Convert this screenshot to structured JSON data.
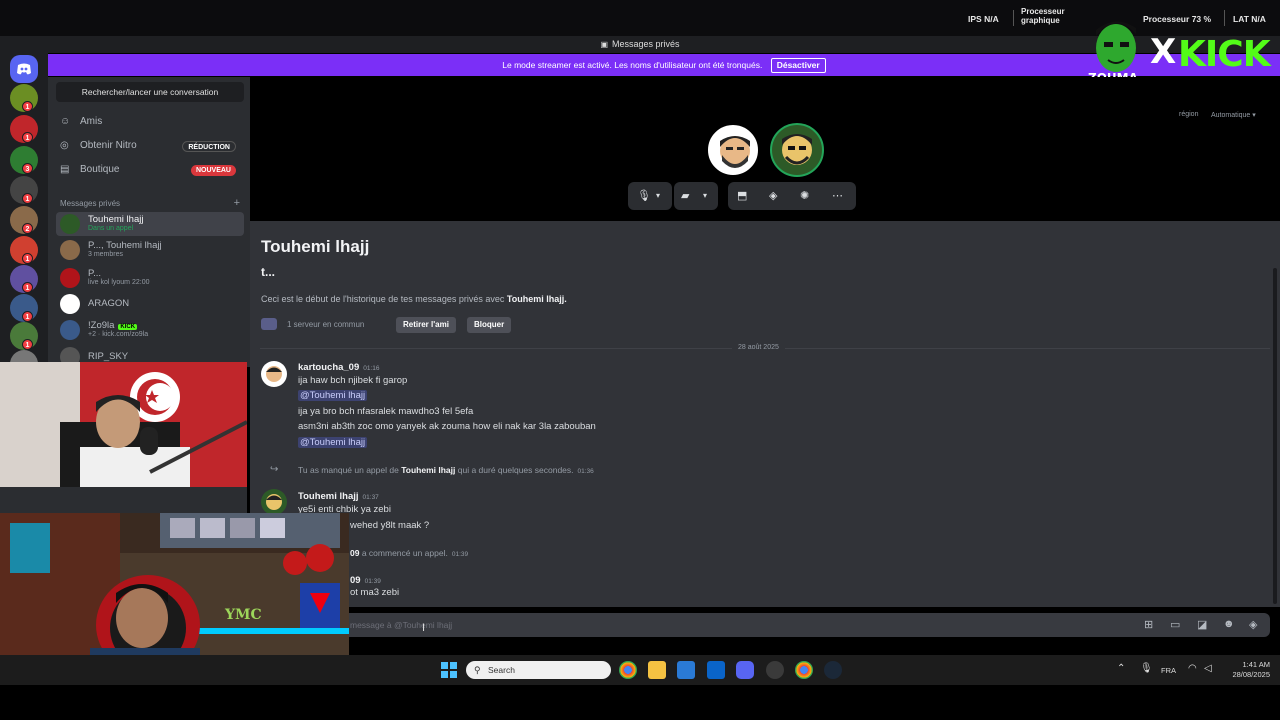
{
  "perf": {
    "ips_label": "IPS",
    "ips_value": "N/A",
    "gpu_label_1": "Processeur",
    "gpu_label_2": "graphique",
    "cpu_label": "Processeur",
    "cpu_value": "73 %",
    "lat_label": "LAT",
    "lat_value": "N/A"
  },
  "overlay": {
    "kick_text": "KICK",
    "x_text": "X",
    "zouma_text": "ZOUMA"
  },
  "window": {
    "title": "Messages privés"
  },
  "streamer": {
    "message": "Le mode streamer est activé. Les noms d'utilisateur ont été tronqués.",
    "button": "Désactiver"
  },
  "rail_badges": [
    "1",
    "1",
    "3",
    "1",
    "2",
    "1",
    "1",
    "1",
    "1"
  ],
  "sidebar": {
    "search": "Rechercher/lancer une conversation",
    "friends": "Amis",
    "nitro": "Obtenir Nitro",
    "nitro_pill": "RÉDUCTION",
    "shop": "Boutique",
    "shop_pill": "NOUVEAU",
    "dm_header": "Messages privés",
    "dm_add": "+",
    "dms": [
      {
        "name": "Touhemi lhajj",
        "sub": "Dans un appel"
      },
      {
        "name": "P..., Touhemi lhajj",
        "sub": "3 membres"
      },
      {
        "name": "P...",
        "sub": "live kol lyoum 22:00"
      },
      {
        "name": "ARAGON",
        "sub": ""
      },
      {
        "name": "!Zo9la",
        "tag": "KICK",
        "sub": "+2 · kick.com/zo9la"
      },
      {
        "name": "RIP_SKY",
        "sub": ""
      }
    ]
  },
  "call": {
    "region_label": "région",
    "region_value": "Automatique"
  },
  "chat": {
    "title": "Touhemi lhajj",
    "subtitle": "t...",
    "intro_prefix": "Ceci est le début de l'historique de tes messages privés avec",
    "intro_name": "Touhemi lhajj.",
    "common": "1 serveur en commun",
    "remove_friend": "Retirer l'ami",
    "block": "Bloquer",
    "date_divider": "28 août 2025",
    "msg1_author": "kartoucha_09",
    "msg1_time": "01:16",
    "msg1_lines": [
      "ija haw bch njibek fi garop",
      "@Touhemi lhajj",
      "ija ya bro bch nfasralek mawdho3 fel 5efa",
      "asm3ni ab3th zoc omo yanyek ak zouma how eli nak kar 3la zabouban",
      "@Touhemi lhajj"
    ],
    "missed_prefix": "Tu as manqué un appel de",
    "missed_name": "Touhemi lhajj",
    "missed_suffix": "qui a duré quelques secondes.",
    "missed_time": "01:36",
    "msg2_author": "Touhemi lhajj",
    "msg2_time": "01:37",
    "msg2_lines": [
      "ye5i enti chbik ya zebi",
      "wehed y8lt maak ?"
    ],
    "started_author": "09",
    "started_text": "a commencé un appel.",
    "started_time": "01:39",
    "msg3_author": "09",
    "msg3_time": "01:39",
    "msg3_line": "ot ma3 zebi",
    "input_placeholder": "message à @Touhemi lhajj"
  },
  "cam2": {
    "sign": "YMC"
  },
  "taskbar": {
    "search": "Search",
    "lang": "FRA",
    "time": "1:41 AM",
    "date": "28/08/2025"
  },
  "colors": {
    "streamer": "#7b2ff7",
    "kick": "#53fc18",
    "hangup": "#da373c",
    "discord": "#5865f2"
  }
}
